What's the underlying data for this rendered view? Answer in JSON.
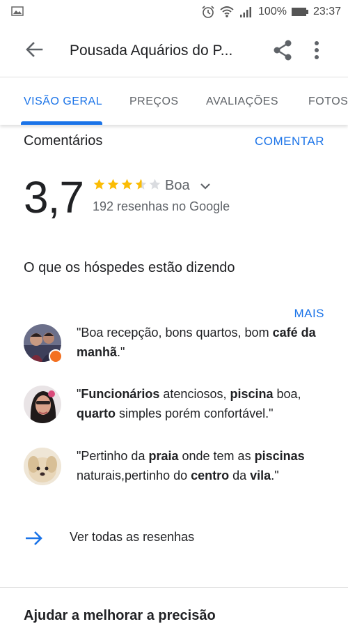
{
  "statusbar": {
    "battery_percent": "100%",
    "time": "23:37",
    "icons": [
      "image-icon",
      "alarm-icon",
      "wifi-icon",
      "signal-icon",
      "battery-icon"
    ]
  },
  "appbar": {
    "title": "Pousada Aquários do P..."
  },
  "tabs": [
    {
      "label": "VISÃO GERAL",
      "active": true
    },
    {
      "label": "PREÇOS",
      "active": false
    },
    {
      "label": "AVALIAÇÕES",
      "active": false
    },
    {
      "label": "FOTOS",
      "active": false
    }
  ],
  "reviews_section": {
    "title": "Comentários",
    "comment_action": "COMENTAR",
    "rating": "3,7",
    "rating_value": 3.7,
    "rating_word": "Boa",
    "review_count": "192 resenhas no Google"
  },
  "guests": {
    "heading": "O que os hóspedes estão dizendo",
    "more": "MAIS",
    "snippets": [
      {
        "segments": [
          {
            "t": "\"Boa recepção, bons quartos, bom ",
            "b": false
          },
          {
            "t": "café da manhã",
            "b": true
          },
          {
            "t": ".\"",
            "b": false
          }
        ]
      },
      {
        "segments": [
          {
            "t": "\"",
            "b": false
          },
          {
            "t": "Funcionários",
            "b": true
          },
          {
            "t": " atenciosos, ",
            "b": false
          },
          {
            "t": "piscina",
            "b": true
          },
          {
            "t": " boa, ",
            "b": false
          },
          {
            "t": "quarto",
            "b": true
          },
          {
            "t": " simples porém confortável.\"",
            "b": false
          }
        ]
      },
      {
        "segments": [
          {
            "t": "\"Pertinho da ",
            "b": false
          },
          {
            "t": "praia",
            "b": true
          },
          {
            "t": " onde tem as ",
            "b": false
          },
          {
            "t": "piscinas",
            "b": true
          },
          {
            "t": " naturais,pertinho do ",
            "b": false
          },
          {
            "t": "centro",
            "b": true
          },
          {
            "t": " da ",
            "b": false
          },
          {
            "t": "vila",
            "b": true
          },
          {
            "t": ".\"",
            "b": false
          }
        ]
      }
    ]
  },
  "all_reviews": {
    "label": "Ver todas as resenhas"
  },
  "next_section": {
    "title": "Ajudar a melhorar a precisão"
  },
  "colors": {
    "accent": "#1a73e8",
    "star": "#fbbc04",
    "star_empty": "#dadce0"
  }
}
